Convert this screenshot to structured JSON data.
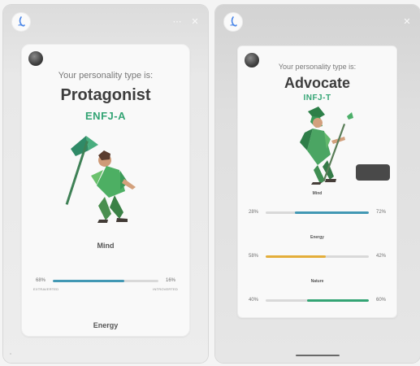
{
  "colors": {
    "green": "#33a474",
    "blue": "#4298b4",
    "gold": "#e4ae3a",
    "teal": "#33a474",
    "bar_track": "#d9d9d9"
  },
  "stories": [
    {
      "story_time": "",
      "icons": {
        "avatar": "story-avatar-icon",
        "menu": "more-icon",
        "close": "close-icon"
      },
      "card": {
        "intro": "Your personality type is:",
        "title": "Protagonist",
        "code": "ENFJ-A",
        "figure": "protagonist-figure",
        "mind": {
          "label": "Mind",
          "left_percent": "68%",
          "right_percent": "16%",
          "left_label": "EXTRAVERTED",
          "right_label": "INTROVERTED",
          "fill_left": 0.68,
          "color": "#4298b4"
        },
        "energy_label": "Energy"
      }
    },
    {
      "story_time": "",
      "icons": {
        "avatar": "story-avatar-icon",
        "close": "close-icon"
      },
      "card": {
        "intro": "Your personality type is:",
        "title": "Advocate",
        "code": "INFJ-T",
        "figure": "advocate-figure",
        "traits": [
          {
            "name": "Mind",
            "left_percent": "28%",
            "right_percent": "72%",
            "fill_right": 0.72,
            "color": "#4298b4"
          },
          {
            "name": "Energy",
            "left_percent": "58%",
            "right_percent": "42%",
            "fill_left": 0.58,
            "color": "#e4ae3a"
          },
          {
            "name": "Nature",
            "left_percent": "40%",
            "right_percent": "60%",
            "fill_right": 0.6,
            "color": "#33a474"
          }
        ]
      }
    }
  ]
}
